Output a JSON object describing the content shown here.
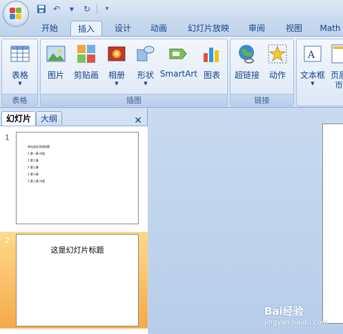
{
  "quick_access": {
    "icons": [
      "save-icon",
      "undo-icon",
      "dropdown-arrow-icon",
      "redo-icon",
      "customize-icon"
    ]
  },
  "tabs": [
    {
      "label": "开始"
    },
    {
      "label": "插入"
    },
    {
      "label": "设计"
    },
    {
      "label": "动画"
    },
    {
      "label": "幻灯片放映"
    },
    {
      "label": "审阅"
    },
    {
      "label": "视图"
    },
    {
      "label": "Math"
    }
  ],
  "ribbon": {
    "groups": {
      "table": "表格",
      "illustrations": "插图",
      "links": "链接"
    },
    "buttons": {
      "table": "表格",
      "picture": "图片",
      "clipart": "剪贴画",
      "album": "相册",
      "shapes": "形状",
      "smartart": "SmartArt",
      "chart": "图表",
      "hyperlink": "超链接",
      "action": "动作",
      "textbox": "文本框",
      "header": "页眉",
      "header_cont": "页"
    }
  },
  "panel": {
    "tab_slides": "幻灯片",
    "tab_outline": "大纲",
    "close": "✕",
    "slides": [
      {
        "num": "1",
        "lines": [
          "单击此处添加标题",
          "1  第一章  内容",
          "   1  第二章",
          "2  第二章",
          "   1  第二章",
          "3  第三章  内容"
        ]
      },
      {
        "num": "2",
        "title": "这是幻灯片标题"
      }
    ]
  },
  "watermark": {
    "brand": "Bai经验",
    "url": "jingyan.baidu.com"
  },
  "colors": {
    "accent": "#15428b",
    "selected": "#f6a94a"
  }
}
